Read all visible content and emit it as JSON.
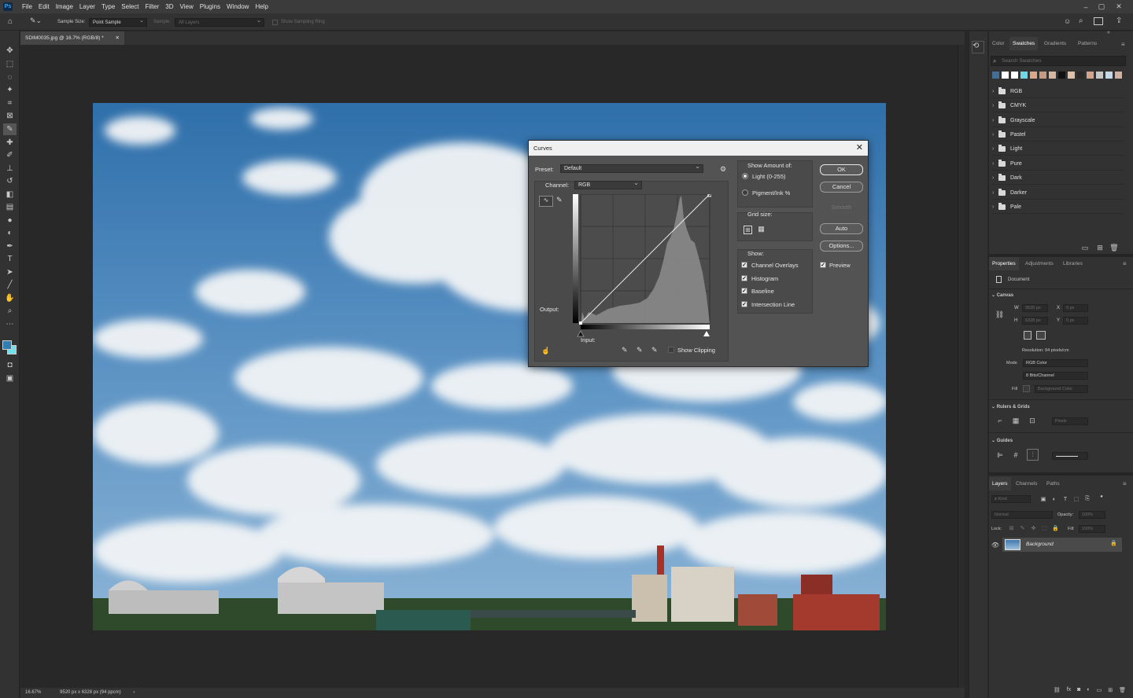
{
  "menubar": {
    "app_logo": "Ps",
    "items": [
      "File",
      "Edit",
      "Image",
      "Layer",
      "Type",
      "Select",
      "Filter",
      "3D",
      "View",
      "Plugins",
      "Window",
      "Help"
    ],
    "window_controls": [
      "–",
      "▢",
      "✕"
    ]
  },
  "optionsbar": {
    "sample_size_label": "Sample Size:",
    "sample_size_value": "Point Sample",
    "sample_label": "Sample:",
    "sample_value": "All Layers",
    "show_sampling_ring": "Show Sampling Ring"
  },
  "document": {
    "tab_title": "SDIM0035.jpg @ 16.7% (RGB/8) *",
    "zoom": "16.67%",
    "dimensions": "9520 px x 6328 px (94 ppcm)"
  },
  "curves": {
    "title": "Curves",
    "preset_label": "Preset:",
    "preset_value": "Default",
    "channel_label": "Channel:",
    "channel_value": "RGB",
    "output_label": "Output:",
    "input_label": "Input:",
    "show_clipping": "Show Clipping",
    "show_amount_label": "Show Amount of:",
    "light_label": "Light  (0-255)",
    "pigment_label": "Pigment/Ink %",
    "grid_size_label": "Grid size:",
    "show_label": "Show:",
    "options": {
      "channel_overlays": "Channel Overlays",
      "histogram": "Histogram",
      "baseline": "Baseline",
      "intersection_line": "Intersection Line"
    },
    "preview_label": "Preview",
    "buttons": {
      "ok": "OK",
      "cancel": "Cancel",
      "smooth": "Smooth",
      "auto": "Auto",
      "options": "Options..."
    }
  },
  "swatches_panel": {
    "tabs": [
      "Color",
      "Swatches",
      "Gradients",
      "Patterns"
    ],
    "active_tab": "Swatches",
    "search_placeholder": "Search Swatches",
    "recent_colors": [
      "#3f6f9a",
      "#ffffff",
      "#ffffff",
      "#6fd6e6",
      "#d9a88a",
      "#c49a82",
      "#d6b8a2",
      "#111111",
      "#e0c0a6",
      "#2a2a2a",
      "#d4a58c",
      "#c8c8c8",
      "#c4d8e8",
      "#d0b0a0"
    ],
    "groups": [
      "RGB",
      "CMYK",
      "Grayscale",
      "Pastel",
      "Light",
      "Pure",
      "Dark",
      "Darker",
      "Pale"
    ]
  },
  "properties_panel": {
    "tabs": [
      "Properties",
      "Adjustments",
      "Libraries"
    ],
    "active_tab": "Properties",
    "doc_label": "Document",
    "canvas_section": "Canvas",
    "w_label": "W",
    "w_value": "9520 px",
    "h_label": "H",
    "h_value": "6328 px",
    "x_label": "X",
    "x_value": "0 px",
    "y_label": "Y",
    "y_value": "0 px",
    "resolution": "Resolution: 94 pixels/cm",
    "mode_label": "Mode",
    "mode_value": "RGB Color",
    "depth_value": "8 Bits/Channel",
    "fill_label": "Fill",
    "fill_value": "Background Color",
    "rulers_section": "Rulers & Grids",
    "rulers_unit": "Pixels",
    "guides_section": "Guides"
  },
  "layers_panel": {
    "tabs": [
      "Layers",
      "Channels",
      "Paths"
    ],
    "active_tab": "Layers",
    "kind_placeholder": "Kind",
    "blend_mode": "Normal",
    "opacity_label": "Opacity:",
    "opacity_value": "100%",
    "lock_label": "Lock:",
    "fill_label": "Fill:",
    "fill_value": "100%",
    "layers": [
      {
        "name": "Background",
        "visible": true,
        "locked": true
      }
    ]
  },
  "colors": {
    "dialog_bg": "#535353",
    "panel_bg": "#323232",
    "foreground": "#2f7fb5",
    "background": "#6fe0ee"
  }
}
